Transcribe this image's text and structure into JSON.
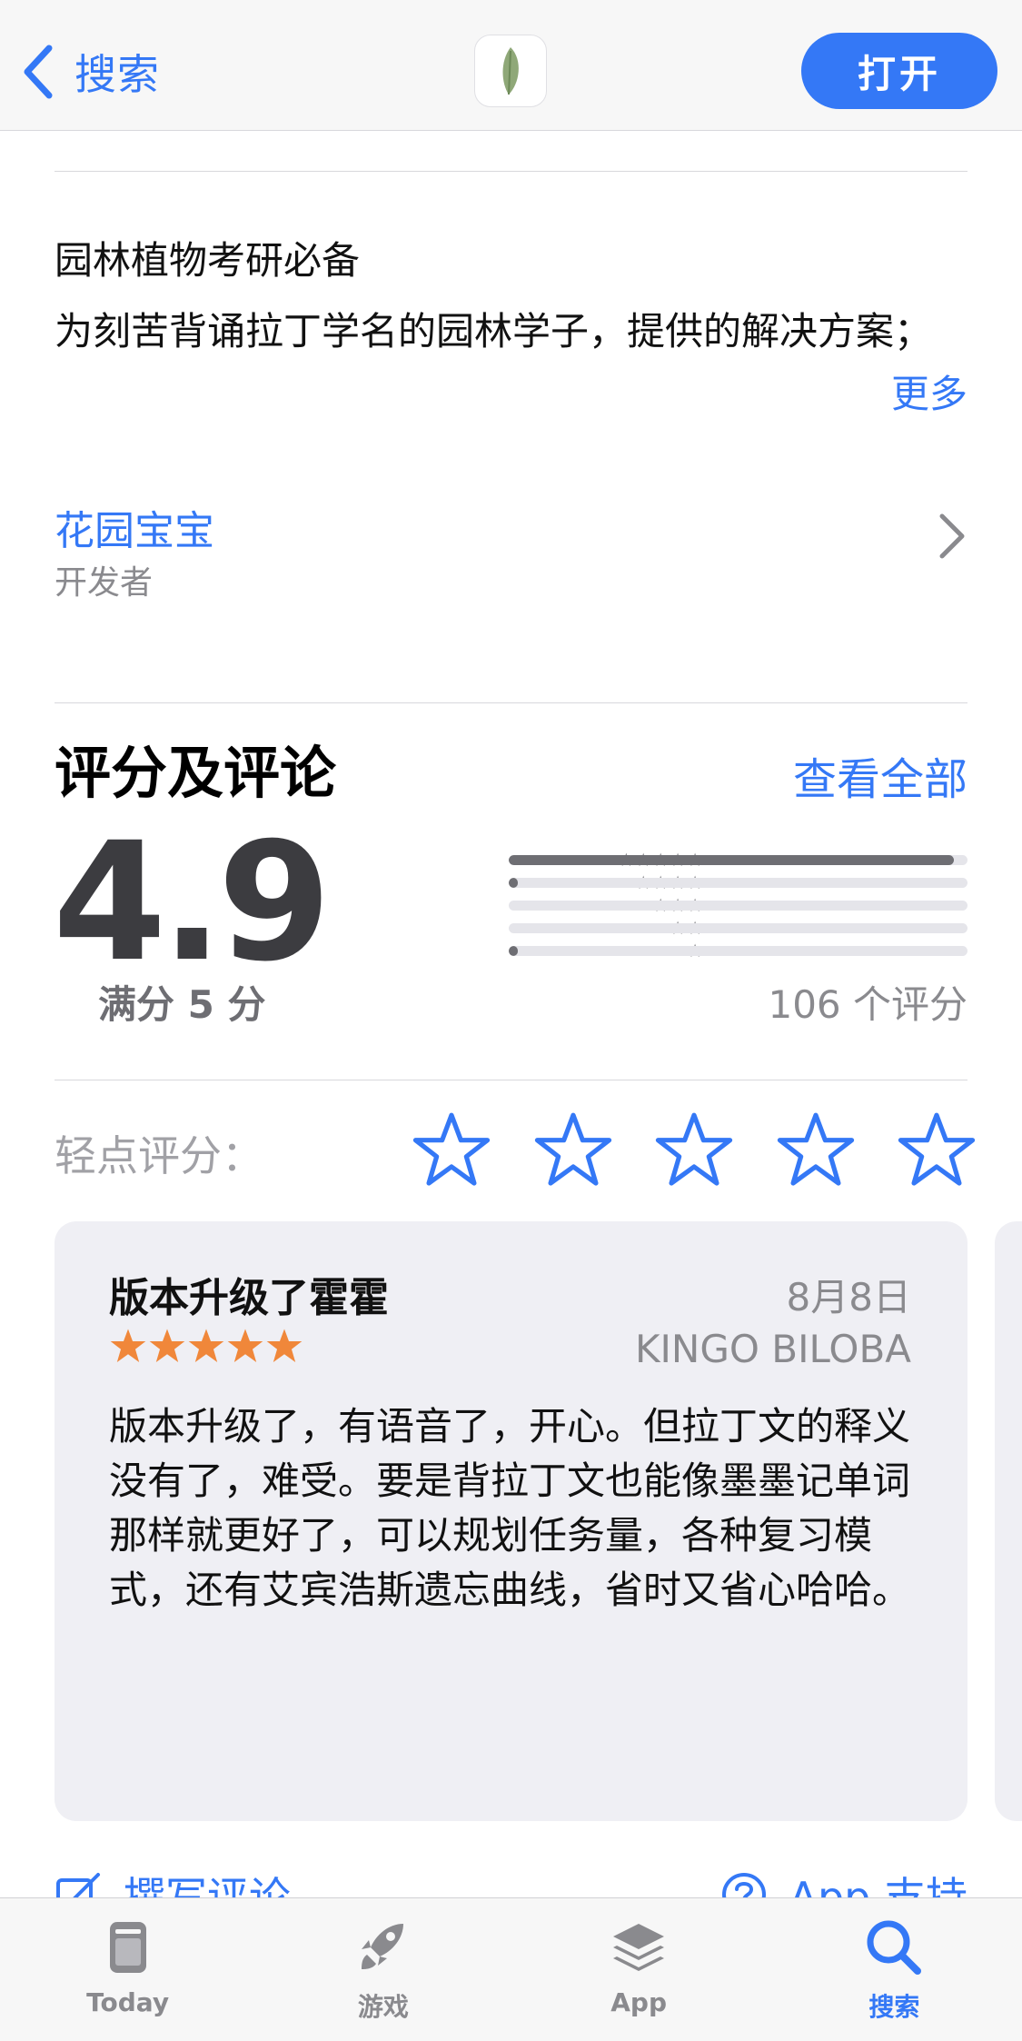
{
  "nav": {
    "back_label": "搜索",
    "open_button": "打开",
    "app_icon": "leaf-icon"
  },
  "description": {
    "line1": "园林植物考研必备",
    "line2": "为刻苦背诵拉丁学名的园林学子，提供的解决方案；",
    "more": "更多"
  },
  "developer": {
    "name": "花园宝宝",
    "role": "开发者"
  },
  "ratings": {
    "title": "评分及评论",
    "see_all": "查看全部",
    "score": "4.9",
    "out_of": "满分 5 分",
    "count_label": "106 个评分",
    "distribution": [
      {
        "stars": "★★★★★",
        "fraction": 0.97
      },
      {
        "stars": "★★★★",
        "fraction": 0.01
      },
      {
        "stars": "★★★",
        "fraction": 0.0
      },
      {
        "stars": "★★",
        "fraction": 0.0
      },
      {
        "stars": "★",
        "fraction": 0.01
      }
    ]
  },
  "tap_to_rate": {
    "label": "轻点评分：",
    "star_count": 5
  },
  "review": {
    "title": "版本升级了霍霍",
    "date": "8月8日",
    "rating": 5,
    "author": "KINGO BILOBA",
    "body": "版本升级了，有语音了，开心。但拉丁文的释义没有了，难受。要是背拉丁文也能像墨墨记单词那样就更好了，可以规划任务量，各种复习模式，还有艾宾浩斯遗忘曲线，省时又省心哈哈。"
  },
  "links": {
    "write_review": "撰写评论",
    "app_support": "App 支持"
  },
  "tabs": [
    {
      "label": "Today",
      "icon": "today-icon",
      "active": false
    },
    {
      "label": "游戏",
      "icon": "rocket-icon",
      "active": false
    },
    {
      "label": "App",
      "icon": "layers-icon",
      "active": false
    },
    {
      "label": "搜索",
      "icon": "search-icon",
      "active": true
    }
  ],
  "colors": {
    "accent": "#3478f6",
    "review_star": "#f0873a",
    "bar_fill": "#6e6e73"
  }
}
